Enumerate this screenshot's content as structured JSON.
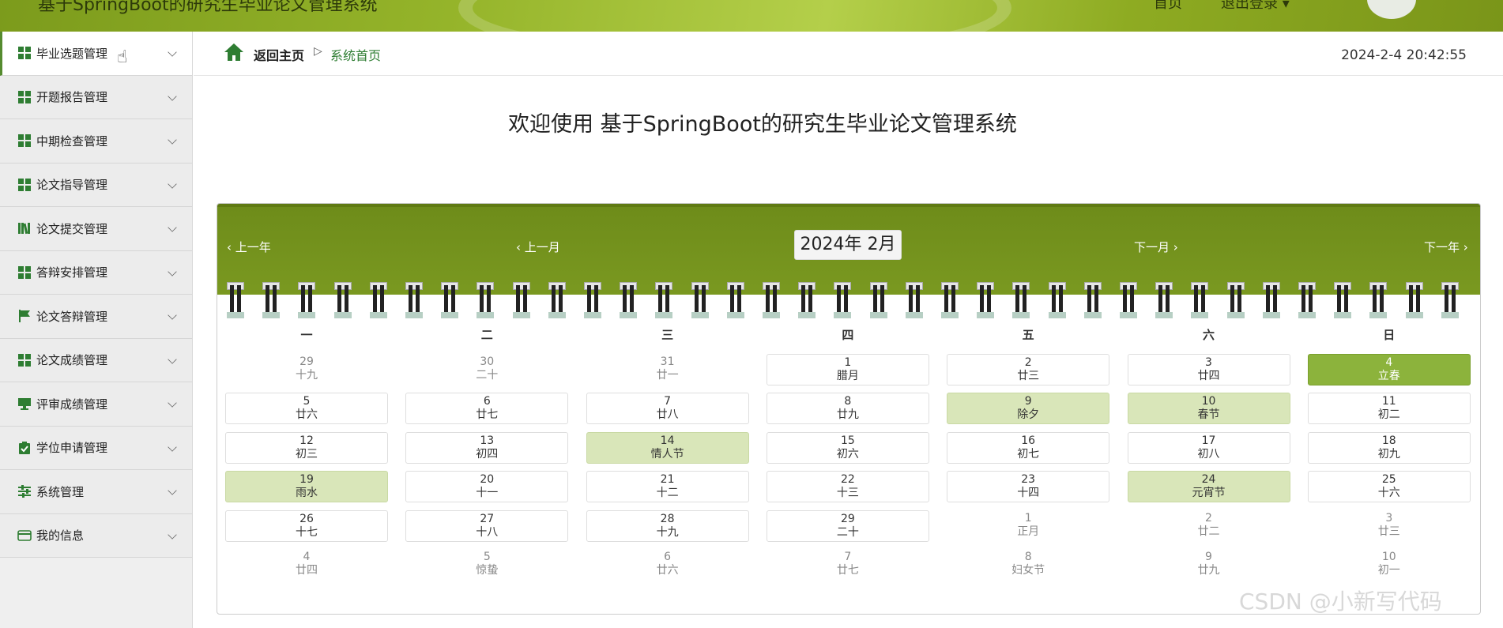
{
  "header": {
    "title": "基于SpringBoot的研究生毕业论文管理系统",
    "right_label1": "首页",
    "right_label2": "退出登录 ▾"
  },
  "sidebar": {
    "items": [
      {
        "label": "毕业选题管理",
        "icon": "grid-icon"
      },
      {
        "label": "开题报告管理",
        "icon": "grid-icon"
      },
      {
        "label": "中期检查管理",
        "icon": "grid-icon"
      },
      {
        "label": "论文指导管理",
        "icon": "grid-icon"
      },
      {
        "label": "论文提交管理",
        "icon": "books-icon"
      },
      {
        "label": "答辩安排管理",
        "icon": "grid-icon"
      },
      {
        "label": "论文答辩管理",
        "icon": "flag-icon"
      },
      {
        "label": "论文成绩管理",
        "icon": "grid-icon"
      },
      {
        "label": "评审成绩管理",
        "icon": "monitor-icon"
      },
      {
        "label": "学位申请管理",
        "icon": "clipboard-icon"
      },
      {
        "label": "系统管理",
        "icon": "sliders-icon"
      },
      {
        "label": "我的信息",
        "icon": "wallet-icon"
      }
    ]
  },
  "breadcrumb": {
    "back": "返回主页",
    "arrow": "▷",
    "current": "系统首页",
    "datetime": "2024-2-4 20:42:55"
  },
  "welcome": "欢迎使用 基于SpringBoot的研究生毕业论文管理系统",
  "calendar": {
    "prev_year": "上一年",
    "prev_month": "上一月",
    "month_label": "2024年 2月",
    "next_month": "下一月",
    "next_year": "下一年",
    "weekdays": [
      "一",
      "二",
      "三",
      "四",
      "五",
      "六",
      "日"
    ],
    "colors": {
      "header": "#7d9c22",
      "highlight": "#d9e6b9",
      "today": "#8cb33c"
    },
    "rows": [
      [
        {
          "d": "29",
          "l": "十九",
          "t": "other"
        },
        {
          "d": "30",
          "l": "二十",
          "t": "other"
        },
        {
          "d": "31",
          "l": "廿一",
          "t": "other"
        },
        {
          "d": "1",
          "l": "腊月",
          "t": "cur"
        },
        {
          "d": "2",
          "l": "廿三",
          "t": "cur"
        },
        {
          "d": "3",
          "l": "廿四",
          "t": "cur"
        },
        {
          "d": "4",
          "l": "立春",
          "t": "today"
        }
      ],
      [
        {
          "d": "5",
          "l": "廿六",
          "t": "cur"
        },
        {
          "d": "6",
          "l": "廿七",
          "t": "cur"
        },
        {
          "d": "7",
          "l": "廿八",
          "t": "cur"
        },
        {
          "d": "8",
          "l": "廿九",
          "t": "cur"
        },
        {
          "d": "9",
          "l": "除夕",
          "t": "hl"
        },
        {
          "d": "10",
          "l": "春节",
          "t": "hl"
        },
        {
          "d": "11",
          "l": "初二",
          "t": "cur"
        }
      ],
      [
        {
          "d": "12",
          "l": "初三",
          "t": "cur"
        },
        {
          "d": "13",
          "l": "初四",
          "t": "cur"
        },
        {
          "d": "14",
          "l": "情人节",
          "t": "hl"
        },
        {
          "d": "15",
          "l": "初六",
          "t": "cur"
        },
        {
          "d": "16",
          "l": "初七",
          "t": "cur"
        },
        {
          "d": "17",
          "l": "初八",
          "t": "cur"
        },
        {
          "d": "18",
          "l": "初九",
          "t": "cur"
        }
      ],
      [
        {
          "d": "19",
          "l": "雨水",
          "t": "hl"
        },
        {
          "d": "20",
          "l": "十一",
          "t": "cur"
        },
        {
          "d": "21",
          "l": "十二",
          "t": "cur"
        },
        {
          "d": "22",
          "l": "十三",
          "t": "cur"
        },
        {
          "d": "23",
          "l": "十四",
          "t": "cur"
        },
        {
          "d": "24",
          "l": "元宵节",
          "t": "hl"
        },
        {
          "d": "25",
          "l": "十六",
          "t": "cur"
        }
      ],
      [
        {
          "d": "26",
          "l": "十七",
          "t": "cur"
        },
        {
          "d": "27",
          "l": "十八",
          "t": "cur"
        },
        {
          "d": "28",
          "l": "十九",
          "t": "cur"
        },
        {
          "d": "29",
          "l": "二十",
          "t": "cur"
        },
        {
          "d": "1",
          "l": "正月",
          "t": "other"
        },
        {
          "d": "2",
          "l": "廿二",
          "t": "other"
        },
        {
          "d": "3",
          "l": "廿三",
          "t": "other"
        }
      ],
      [
        {
          "d": "4",
          "l": "廿四",
          "t": "other"
        },
        {
          "d": "5",
          "l": "惊蛰",
          "t": "other"
        },
        {
          "d": "6",
          "l": "廿六",
          "t": "other"
        },
        {
          "d": "7",
          "l": "廿七",
          "t": "other"
        },
        {
          "d": "8",
          "l": "妇女节",
          "t": "other"
        },
        {
          "d": "9",
          "l": "廿九",
          "t": "other"
        },
        {
          "d": "10",
          "l": "初一",
          "t": "other"
        }
      ]
    ]
  },
  "watermark": "CSDN @小新写代码"
}
